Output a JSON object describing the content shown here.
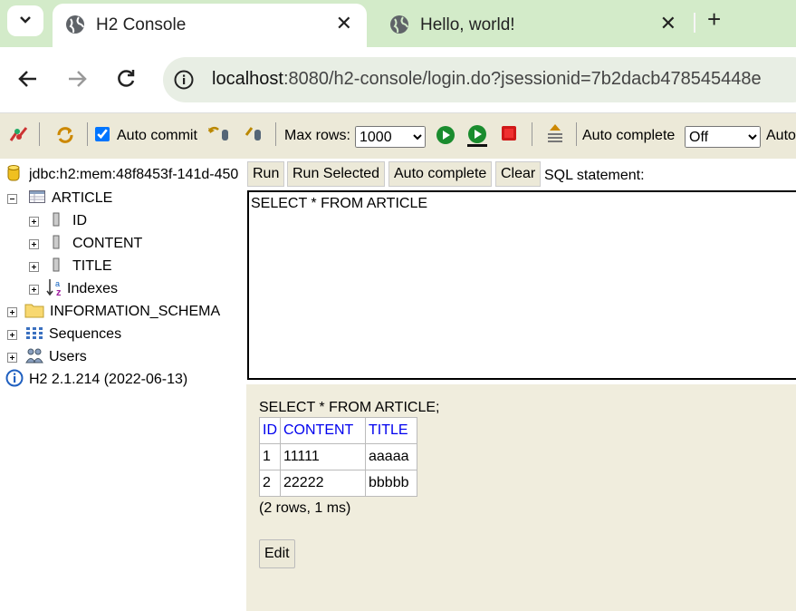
{
  "browser": {
    "tabs": [
      {
        "title": "H2 Console",
        "active": true
      },
      {
        "title": "Hello, world!",
        "active": false
      }
    ],
    "url_host": "localhost",
    "url_rest": ":8080/h2-console/login.do?jsessionid=7b2dacb478545448e"
  },
  "toolbar": {
    "auto_commit_label": "Auto commit",
    "auto_commit_checked": true,
    "max_rows_label": "Max rows:",
    "max_rows_value": "1000",
    "auto_complete_label": "Auto complete",
    "auto_complete_value": "Off",
    "auto_label": "Auto"
  },
  "tree": {
    "connection": "jdbc:h2:mem:48f8453f-141d-450",
    "table": "ARTICLE",
    "columns": [
      "ID",
      "CONTENT",
      "TITLE"
    ],
    "indexes": "Indexes",
    "schema": "INFORMATION_SCHEMA",
    "sequences": "Sequences",
    "users": "Users",
    "version": "H2 2.1.214 (2022-06-13)"
  },
  "query": {
    "run": "Run",
    "run_selected": "Run Selected",
    "auto_complete": "Auto complete",
    "clear": "Clear",
    "sql_label": "SQL statement:",
    "sql": "SELECT * FROM ARTICLE"
  },
  "result": {
    "statement": "SELECT * FROM ARTICLE;",
    "headers": [
      "ID",
      "CONTENT",
      "TITLE"
    ],
    "rows": [
      [
        "1",
        "11111",
        "aaaaa"
      ],
      [
        "2",
        "22222",
        "bbbbb"
      ]
    ],
    "summary": "(2 rows, 1 ms)",
    "edit": "Edit"
  },
  "colors": {
    "tabstrip": "#d3ebc9",
    "h2_panel": "#ece9d8",
    "result_bg": "#f0eddd",
    "header_link": "#0000ee"
  }
}
